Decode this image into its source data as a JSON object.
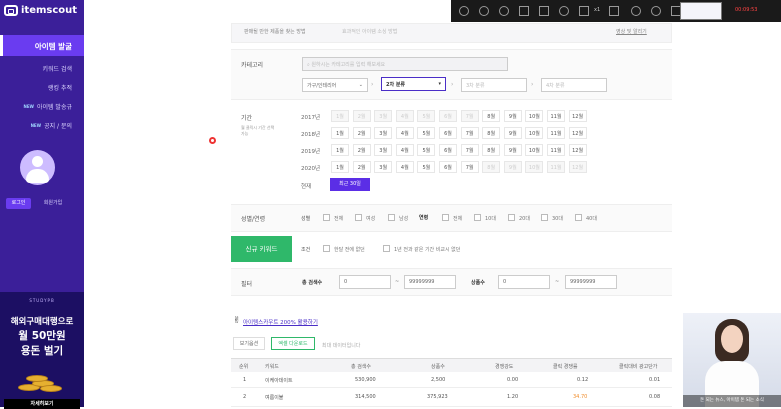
{
  "sidebar": {
    "logo_text": "itemscout",
    "active_menu": "아이템 발굴",
    "items": [
      {
        "label": "키워드 검색",
        "new": ""
      },
      {
        "label": "랭킹 추적",
        "new": ""
      },
      {
        "label": "아이템 발송규",
        "new": "NEW"
      },
      {
        "label": "공지 / 문의",
        "new": "NEW"
      }
    ],
    "login": "로그인",
    "signup": "회원가입",
    "ad": {
      "top": "STUDYPB",
      "line1": "해외구매대행으로",
      "line2": "월 50만원",
      "line3": "용돈 벌기",
      "cta": "자세히보기"
    }
  },
  "topbar": {
    "text1": "x1",
    "rec": "00:09:53"
  },
  "tabs": {
    "tab1": "판매될 만한 제품을 찾는 방법",
    "tab2": "효과적인 아이템 소싱 방법",
    "right": "영상 및 알리기"
  },
  "category": {
    "label": "카테고리",
    "search_placeholder": "원하시는 카테고리를 입력 해보세요",
    "cat1": "가구/인테리어",
    "cat2": "2차 분류",
    "cat3": "3차 분류",
    "cat4": "4차 분류"
  },
  "period": {
    "label": "기간",
    "sub": "월 클릭시 기간 선택 가능",
    "years": [
      "2017년",
      "2018년",
      "2019년",
      "2020년"
    ],
    "current_label": "현재",
    "recent_btn": "최근 30일",
    "months": [
      "1월",
      "2월",
      "3월",
      "4월",
      "5월",
      "6월",
      "7월",
      "8월",
      "9월",
      "10월",
      "11월",
      "12월"
    ]
  },
  "gender": {
    "label": "성별/연령",
    "gender_label": "성별",
    "options": [
      "전체",
      "여성",
      "남성"
    ],
    "age_label": "연령",
    "ages": [
      "전체",
      "10대",
      "20대",
      "30대",
      "40대"
    ]
  },
  "new_keyword": {
    "label": "신규 키워드",
    "cond_label": "조건",
    "cond1": "한달 전에 없던",
    "cond2": "1년 전과 같은 기간 비교시 없던"
  },
  "filter": {
    "label": "필터",
    "total_search": "총 검색수",
    "min": "0",
    "max": "99999999",
    "tilde": "~",
    "products": "상품수",
    "pmin": "0",
    "pmax": "99999999"
  },
  "promo": {
    "emoji": "✌",
    "link": "아이템스카우트 200% 활용하기"
  },
  "controls": {
    "btn1": "보기옵션",
    "btn2": "엑셀 다운로드",
    "note": "최대 데이터입니다"
  },
  "table": {
    "headers": [
      "순위",
      "키워드",
      "총 검색수",
      "상품수",
      "경쟁강도",
      "클릭 경쟁률",
      "클릭대비 광고단가"
    ],
    "rows": [
      [
        "1",
        "이케아데이트",
        "530,900",
        "2,500",
        "0.00",
        "0.12",
        "0.01"
      ],
      [
        "2",
        "여름이불",
        "314,500",
        "375,923",
        "1.20",
        "34.70",
        "0.08"
      ]
    ]
  },
  "webcam": {
    "caption": "돈 되는 뉴스, 아이템 돈 되는 소식"
  },
  "colors": {
    "sidebar_bg": "#3b1f99",
    "accent": "#5b2ee6",
    "green": "#2fb86a"
  }
}
